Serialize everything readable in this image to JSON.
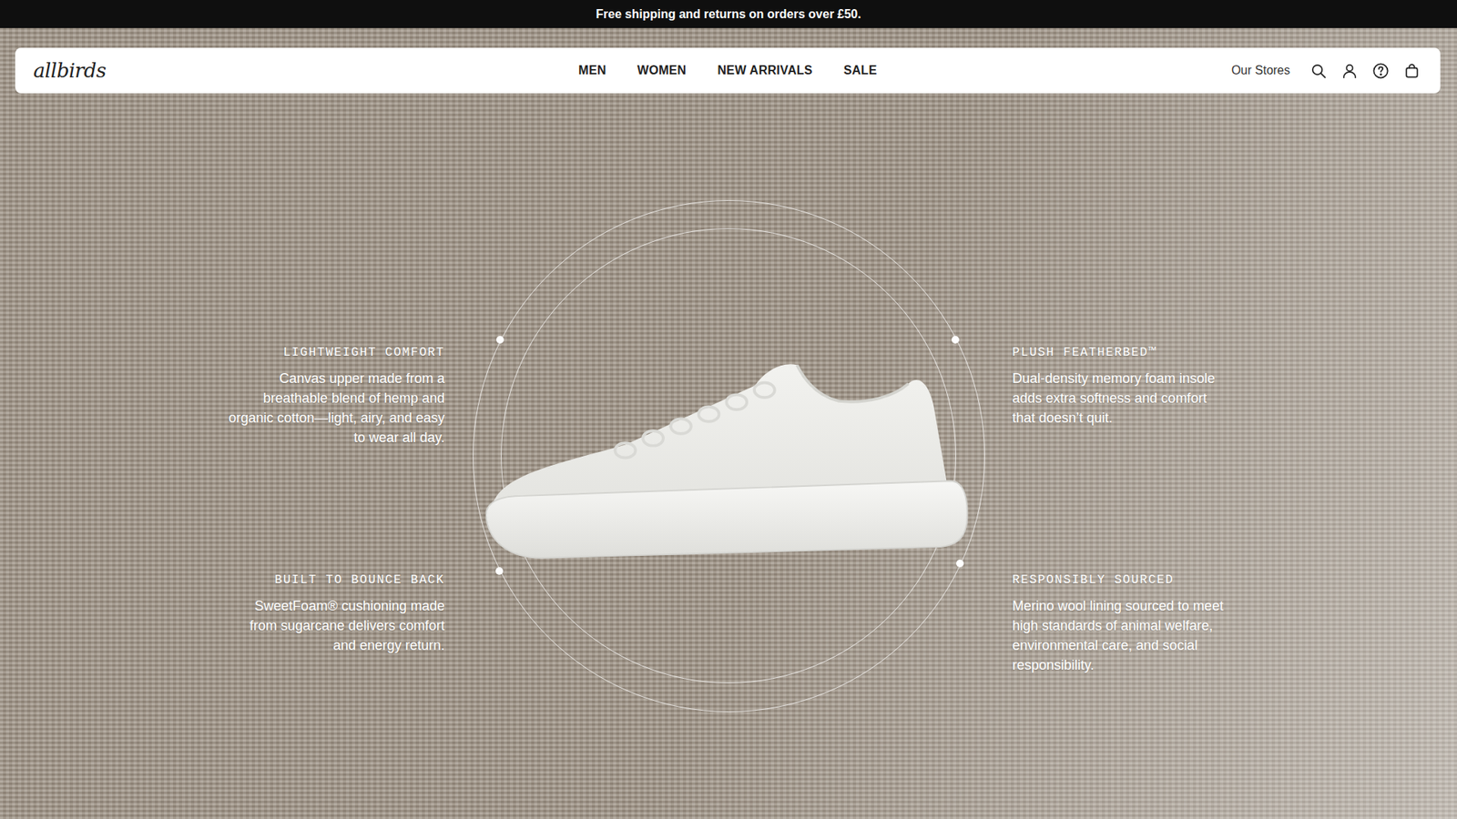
{
  "announcement": "Free shipping and returns on orders over £50.",
  "logo": "allbirds",
  "nav": {
    "items": [
      {
        "label": "MEN"
      },
      {
        "label": "WOMEN"
      },
      {
        "label": "NEW ARRIVALS"
      },
      {
        "label": "SALE"
      }
    ]
  },
  "utility": {
    "stores": "Our Stores"
  },
  "features": {
    "left": [
      {
        "title": "LIGHTWEIGHT COMFORT",
        "text": "Canvas upper made from a breathable blend of hemp and organic cotton—light, airy, and easy to wear all day."
      },
      {
        "title": "BUILT TO BOUNCE BACK",
        "text": "SweetFoam® cushioning made from sugarcane delivers comfort and energy return."
      }
    ],
    "right": [
      {
        "title": "PLUSH FEATHERBED™",
        "text": "Dual-density memory foam insole adds extra softness and comfort that doesn’t quit."
      },
      {
        "title": "RESPONSIBLY SOURCED",
        "text": "Merino wool lining sourced to meet high standards of animal welfare, environmental care, and social responsibility."
      }
    ]
  }
}
